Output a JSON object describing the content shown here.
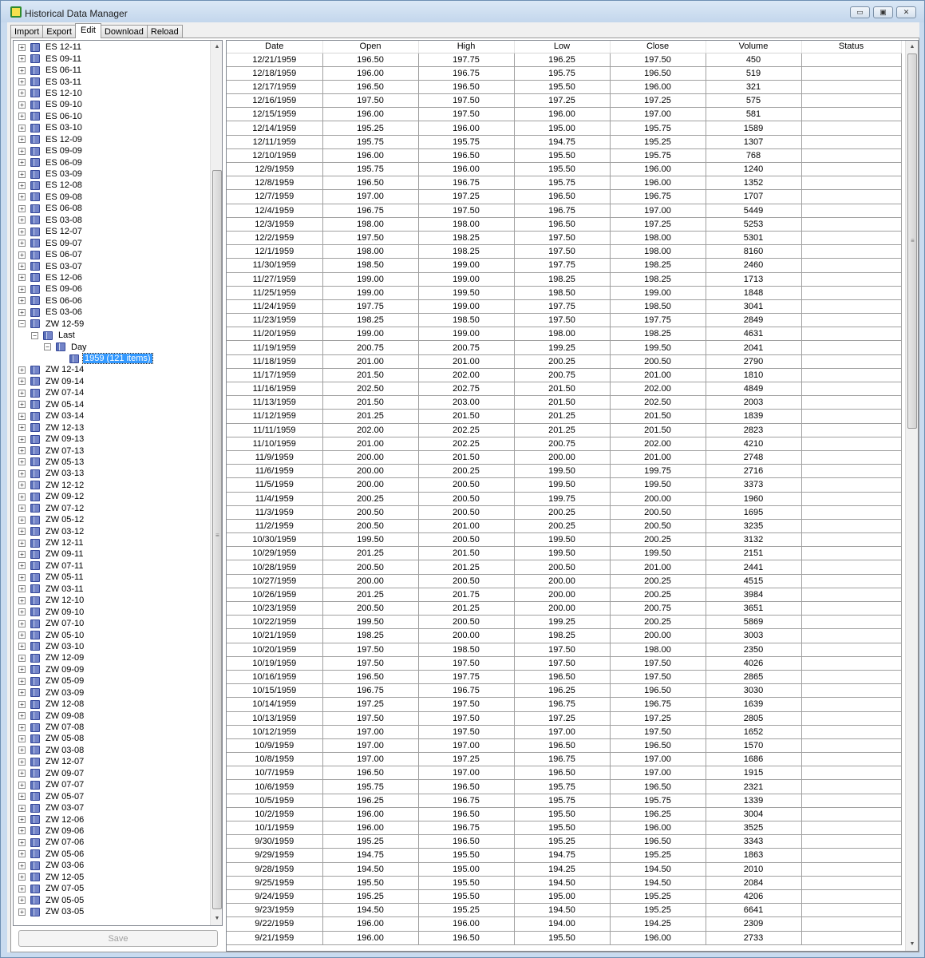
{
  "window": {
    "title": "Historical Data Manager",
    "minimize_glyph": "▭",
    "maximize_glyph": "▣",
    "close_glyph": "✕"
  },
  "tabs": [
    "Import",
    "Export",
    "Edit",
    "Download",
    "Reload"
  ],
  "active_tab": "Edit",
  "tree": {
    "expand_glyph": "+",
    "collapse_glyph": "−",
    "items": [
      {
        "label": "ES 12-11",
        "level": 0,
        "state": "collapsed"
      },
      {
        "label": "ES 09-11",
        "level": 0,
        "state": "collapsed"
      },
      {
        "label": "ES 06-11",
        "level": 0,
        "state": "collapsed"
      },
      {
        "label": "ES 03-11",
        "level": 0,
        "state": "collapsed"
      },
      {
        "label": "ES 12-10",
        "level": 0,
        "state": "collapsed"
      },
      {
        "label": "ES 09-10",
        "level": 0,
        "state": "collapsed"
      },
      {
        "label": "ES 06-10",
        "level": 0,
        "state": "collapsed"
      },
      {
        "label": "ES 03-10",
        "level": 0,
        "state": "collapsed"
      },
      {
        "label": "ES 12-09",
        "level": 0,
        "state": "collapsed"
      },
      {
        "label": "ES 09-09",
        "level": 0,
        "state": "collapsed"
      },
      {
        "label": "ES 06-09",
        "level": 0,
        "state": "collapsed"
      },
      {
        "label": "ES 03-09",
        "level": 0,
        "state": "collapsed"
      },
      {
        "label": "ES 12-08",
        "level": 0,
        "state": "collapsed"
      },
      {
        "label": "ES 09-08",
        "level": 0,
        "state": "collapsed"
      },
      {
        "label": "ES 06-08",
        "level": 0,
        "state": "collapsed"
      },
      {
        "label": "ES 03-08",
        "level": 0,
        "state": "collapsed"
      },
      {
        "label": "ES 12-07",
        "level": 0,
        "state": "collapsed"
      },
      {
        "label": "ES 09-07",
        "level": 0,
        "state": "collapsed"
      },
      {
        "label": "ES 06-07",
        "level": 0,
        "state": "collapsed"
      },
      {
        "label": "ES 03-07",
        "level": 0,
        "state": "collapsed"
      },
      {
        "label": "ES 12-06",
        "level": 0,
        "state": "collapsed"
      },
      {
        "label": "ES 09-06",
        "level": 0,
        "state": "collapsed"
      },
      {
        "label": "ES 06-06",
        "level": 0,
        "state": "collapsed"
      },
      {
        "label": "ES 03-06",
        "level": 0,
        "state": "collapsed"
      },
      {
        "label": "ZW 12-59",
        "level": 0,
        "state": "expanded"
      },
      {
        "label": "Last",
        "level": 1,
        "state": "expanded"
      },
      {
        "label": "Day",
        "level": 2,
        "state": "expanded"
      },
      {
        "label": "1959 (121 items)",
        "level": 3,
        "state": "leaf",
        "selected": true
      },
      {
        "label": "ZW 12-14",
        "level": 0,
        "state": "collapsed"
      },
      {
        "label": "ZW 09-14",
        "level": 0,
        "state": "collapsed"
      },
      {
        "label": "ZW 07-14",
        "level": 0,
        "state": "collapsed"
      },
      {
        "label": "ZW 05-14",
        "level": 0,
        "state": "collapsed"
      },
      {
        "label": "ZW 03-14",
        "level": 0,
        "state": "collapsed"
      },
      {
        "label": "ZW 12-13",
        "level": 0,
        "state": "collapsed"
      },
      {
        "label": "ZW 09-13",
        "level": 0,
        "state": "collapsed"
      },
      {
        "label": "ZW 07-13",
        "level": 0,
        "state": "collapsed"
      },
      {
        "label": "ZW 05-13",
        "level": 0,
        "state": "collapsed"
      },
      {
        "label": "ZW 03-13",
        "level": 0,
        "state": "collapsed"
      },
      {
        "label": "ZW 12-12",
        "level": 0,
        "state": "collapsed"
      },
      {
        "label": "ZW 09-12",
        "level": 0,
        "state": "collapsed"
      },
      {
        "label": "ZW 07-12",
        "level": 0,
        "state": "collapsed"
      },
      {
        "label": "ZW 05-12",
        "level": 0,
        "state": "collapsed"
      },
      {
        "label": "ZW 03-12",
        "level": 0,
        "state": "collapsed"
      },
      {
        "label": "ZW 12-11",
        "level": 0,
        "state": "collapsed"
      },
      {
        "label": "ZW 09-11",
        "level": 0,
        "state": "collapsed"
      },
      {
        "label": "ZW 07-11",
        "level": 0,
        "state": "collapsed"
      },
      {
        "label": "ZW 05-11",
        "level": 0,
        "state": "collapsed"
      },
      {
        "label": "ZW 03-11",
        "level": 0,
        "state": "collapsed"
      },
      {
        "label": "ZW 12-10",
        "level": 0,
        "state": "collapsed"
      },
      {
        "label": "ZW 09-10",
        "level": 0,
        "state": "collapsed"
      },
      {
        "label": "ZW 07-10",
        "level": 0,
        "state": "collapsed"
      },
      {
        "label": "ZW 05-10",
        "level": 0,
        "state": "collapsed"
      },
      {
        "label": "ZW 03-10",
        "level": 0,
        "state": "collapsed"
      },
      {
        "label": "ZW 12-09",
        "level": 0,
        "state": "collapsed"
      },
      {
        "label": "ZW 09-09",
        "level": 0,
        "state": "collapsed"
      },
      {
        "label": "ZW 05-09",
        "level": 0,
        "state": "collapsed"
      },
      {
        "label": "ZW 03-09",
        "level": 0,
        "state": "collapsed"
      },
      {
        "label": "ZW 12-08",
        "level": 0,
        "state": "collapsed"
      },
      {
        "label": "ZW 09-08",
        "level": 0,
        "state": "collapsed"
      },
      {
        "label": "ZW 07-08",
        "level": 0,
        "state": "collapsed"
      },
      {
        "label": "ZW 05-08",
        "level": 0,
        "state": "collapsed"
      },
      {
        "label": "ZW 03-08",
        "level": 0,
        "state": "collapsed"
      },
      {
        "label": "ZW 12-07",
        "level": 0,
        "state": "collapsed"
      },
      {
        "label": "ZW 09-07",
        "level": 0,
        "state": "collapsed"
      },
      {
        "label": "ZW 07-07",
        "level": 0,
        "state": "collapsed"
      },
      {
        "label": "ZW 05-07",
        "level": 0,
        "state": "collapsed"
      },
      {
        "label": "ZW 03-07",
        "level": 0,
        "state": "collapsed"
      },
      {
        "label": "ZW 12-06",
        "level": 0,
        "state": "collapsed"
      },
      {
        "label": "ZW 09-06",
        "level": 0,
        "state": "collapsed"
      },
      {
        "label": "ZW 07-06",
        "level": 0,
        "state": "collapsed"
      },
      {
        "label": "ZW 05-06",
        "level": 0,
        "state": "collapsed"
      },
      {
        "label": "ZW 03-06",
        "level": 0,
        "state": "collapsed"
      },
      {
        "label": "ZW 12-05",
        "level": 0,
        "state": "collapsed"
      },
      {
        "label": "ZW 07-05",
        "level": 0,
        "state": "collapsed"
      },
      {
        "label": "ZW 05-05",
        "level": 0,
        "state": "collapsed"
      },
      {
        "label": "ZW 03-05",
        "level": 0,
        "state": "collapsed"
      }
    ]
  },
  "save_label": "Save",
  "grid": {
    "columns": [
      "Date",
      "Open",
      "High",
      "Low",
      "Close",
      "Volume",
      "Status"
    ],
    "rows": [
      [
        "12/21/1959",
        "196.50",
        "197.75",
        "196.25",
        "197.50",
        "450",
        ""
      ],
      [
        "12/18/1959",
        "196.00",
        "196.75",
        "195.75",
        "196.50",
        "519",
        ""
      ],
      [
        "12/17/1959",
        "196.50",
        "196.50",
        "195.50",
        "196.00",
        "321",
        ""
      ],
      [
        "12/16/1959",
        "197.50",
        "197.50",
        "197.25",
        "197.25",
        "575",
        ""
      ],
      [
        "12/15/1959",
        "196.00",
        "197.50",
        "196.00",
        "197.00",
        "581",
        ""
      ],
      [
        "12/14/1959",
        "195.25",
        "196.00",
        "195.00",
        "195.75",
        "1589",
        ""
      ],
      [
        "12/11/1959",
        "195.75",
        "195.75",
        "194.75",
        "195.25",
        "1307",
        ""
      ],
      [
        "12/10/1959",
        "196.00",
        "196.50",
        "195.50",
        "195.75",
        "768",
        ""
      ],
      [
        "12/9/1959",
        "195.75",
        "196.00",
        "195.50",
        "196.00",
        "1240",
        ""
      ],
      [
        "12/8/1959",
        "196.50",
        "196.75",
        "195.75",
        "196.00",
        "1352",
        ""
      ],
      [
        "12/7/1959",
        "197.00",
        "197.25",
        "196.50",
        "196.75",
        "1707",
        ""
      ],
      [
        "12/4/1959",
        "196.75",
        "197.50",
        "196.75",
        "197.00",
        "5449",
        ""
      ],
      [
        "12/3/1959",
        "198.00",
        "198.00",
        "196.50",
        "197.25",
        "5253",
        ""
      ],
      [
        "12/2/1959",
        "197.50",
        "198.25",
        "197.50",
        "198.00",
        "5301",
        ""
      ],
      [
        "12/1/1959",
        "198.00",
        "198.25",
        "197.50",
        "198.00",
        "8160",
        ""
      ],
      [
        "11/30/1959",
        "198.50",
        "199.00",
        "197.75",
        "198.25",
        "2460",
        ""
      ],
      [
        "11/27/1959",
        "199.00",
        "199.00",
        "198.25",
        "198.25",
        "1713",
        ""
      ],
      [
        "11/25/1959",
        "199.00",
        "199.50",
        "198.50",
        "199.00",
        "1848",
        ""
      ],
      [
        "11/24/1959",
        "197.75",
        "199.00",
        "197.75",
        "198.50",
        "3041",
        ""
      ],
      [
        "11/23/1959",
        "198.25",
        "198.50",
        "197.50",
        "197.75",
        "2849",
        ""
      ],
      [
        "11/20/1959",
        "199.00",
        "199.00",
        "198.00",
        "198.25",
        "4631",
        ""
      ],
      [
        "11/19/1959",
        "200.75",
        "200.75",
        "199.25",
        "199.50",
        "2041",
        ""
      ],
      [
        "11/18/1959",
        "201.00",
        "201.00",
        "200.25",
        "200.50",
        "2790",
        ""
      ],
      [
        "11/17/1959",
        "201.50",
        "202.00",
        "200.75",
        "201.00",
        "1810",
        ""
      ],
      [
        "11/16/1959",
        "202.50",
        "202.75",
        "201.50",
        "202.00",
        "4849",
        ""
      ],
      [
        "11/13/1959",
        "201.50",
        "203.00",
        "201.50",
        "202.50",
        "2003",
        ""
      ],
      [
        "11/12/1959",
        "201.25",
        "201.50",
        "201.25",
        "201.50",
        "1839",
        ""
      ],
      [
        "11/11/1959",
        "202.00",
        "202.25",
        "201.25",
        "201.50",
        "2823",
        ""
      ],
      [
        "11/10/1959",
        "201.00",
        "202.25",
        "200.75",
        "202.00",
        "4210",
        ""
      ],
      [
        "11/9/1959",
        "200.00",
        "201.50",
        "200.00",
        "201.00",
        "2748",
        ""
      ],
      [
        "11/6/1959",
        "200.00",
        "200.25",
        "199.50",
        "199.75",
        "2716",
        ""
      ],
      [
        "11/5/1959",
        "200.00",
        "200.50",
        "199.50",
        "199.50",
        "3373",
        ""
      ],
      [
        "11/4/1959",
        "200.25",
        "200.50",
        "199.75",
        "200.00",
        "1960",
        ""
      ],
      [
        "11/3/1959",
        "200.50",
        "200.50",
        "200.25",
        "200.50",
        "1695",
        ""
      ],
      [
        "11/2/1959",
        "200.50",
        "201.00",
        "200.25",
        "200.50",
        "3235",
        ""
      ],
      [
        "10/30/1959",
        "199.50",
        "200.50",
        "199.50",
        "200.25",
        "3132",
        ""
      ],
      [
        "10/29/1959",
        "201.25",
        "201.50",
        "199.50",
        "199.50",
        "2151",
        ""
      ],
      [
        "10/28/1959",
        "200.50",
        "201.25",
        "200.50",
        "201.00",
        "2441",
        ""
      ],
      [
        "10/27/1959",
        "200.00",
        "200.50",
        "200.00",
        "200.25",
        "4515",
        ""
      ],
      [
        "10/26/1959",
        "201.25",
        "201.75",
        "200.00",
        "200.25",
        "3984",
        ""
      ],
      [
        "10/23/1959",
        "200.50",
        "201.25",
        "200.00",
        "200.75",
        "3651",
        ""
      ],
      [
        "10/22/1959",
        "199.50",
        "200.50",
        "199.25",
        "200.25",
        "5869",
        ""
      ],
      [
        "10/21/1959",
        "198.25",
        "200.00",
        "198.25",
        "200.00",
        "3003",
        ""
      ],
      [
        "10/20/1959",
        "197.50",
        "198.50",
        "197.50",
        "198.00",
        "2350",
        ""
      ],
      [
        "10/19/1959",
        "197.50",
        "197.50",
        "197.50",
        "197.50",
        "4026",
        ""
      ],
      [
        "10/16/1959",
        "196.50",
        "197.75",
        "196.50",
        "197.50",
        "2865",
        ""
      ],
      [
        "10/15/1959",
        "196.75",
        "196.75",
        "196.25",
        "196.50",
        "3030",
        ""
      ],
      [
        "10/14/1959",
        "197.25",
        "197.50",
        "196.75",
        "196.75",
        "1639",
        ""
      ],
      [
        "10/13/1959",
        "197.50",
        "197.50",
        "197.25",
        "197.25",
        "2805",
        ""
      ],
      [
        "10/12/1959",
        "197.00",
        "197.50",
        "197.00",
        "197.50",
        "1652",
        ""
      ],
      [
        "10/9/1959",
        "197.00",
        "197.00",
        "196.50",
        "196.50",
        "1570",
        ""
      ],
      [
        "10/8/1959",
        "197.00",
        "197.25",
        "196.75",
        "197.00",
        "1686",
        ""
      ],
      [
        "10/7/1959",
        "196.50",
        "197.00",
        "196.50",
        "197.00",
        "1915",
        ""
      ],
      [
        "10/6/1959",
        "195.75",
        "196.50",
        "195.75",
        "196.50",
        "2321",
        ""
      ],
      [
        "10/5/1959",
        "196.25",
        "196.75",
        "195.75",
        "195.75",
        "1339",
        ""
      ],
      [
        "10/2/1959",
        "196.00",
        "196.50",
        "195.50",
        "196.25",
        "3004",
        ""
      ],
      [
        "10/1/1959",
        "196.00",
        "196.75",
        "195.50",
        "196.00",
        "3525",
        ""
      ],
      [
        "9/30/1959",
        "195.25",
        "196.50",
        "195.25",
        "196.50",
        "3343",
        ""
      ],
      [
        "9/29/1959",
        "194.75",
        "195.50",
        "194.75",
        "195.25",
        "1863",
        ""
      ],
      [
        "9/28/1959",
        "194.50",
        "195.00",
        "194.25",
        "194.50",
        "2010",
        ""
      ],
      [
        "9/25/1959",
        "195.50",
        "195.50",
        "194.50",
        "194.50",
        "2084",
        ""
      ],
      [
        "9/24/1959",
        "195.25",
        "195.50",
        "195.00",
        "195.25",
        "4206",
        ""
      ],
      [
        "9/23/1959",
        "194.50",
        "195.25",
        "194.50",
        "195.25",
        "6641",
        ""
      ],
      [
        "9/22/1959",
        "196.00",
        "196.00",
        "194.00",
        "194.25",
        "2309",
        ""
      ],
      [
        "9/21/1959",
        "196.00",
        "196.50",
        "195.50",
        "196.00",
        "2733",
        ""
      ]
    ]
  },
  "scrollbar": {
    "up_glyph": "▲",
    "down_glyph": "▼",
    "grip_glyph": "≡"
  }
}
